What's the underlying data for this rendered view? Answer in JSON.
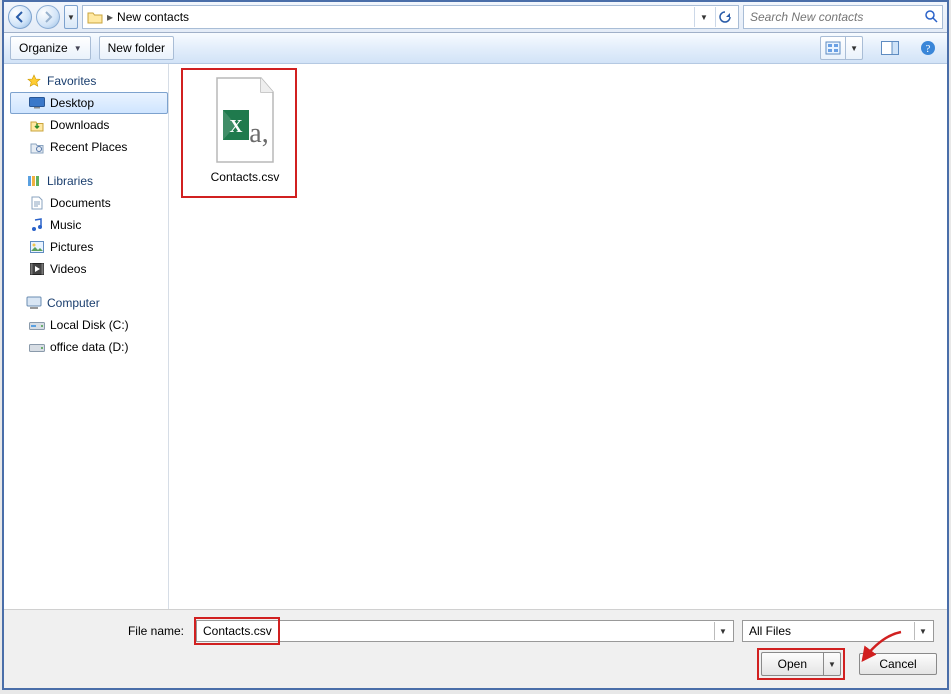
{
  "addressbar": {
    "location": "New contacts",
    "search_placeholder": "Search New contacts"
  },
  "toolbar": {
    "organize": "Organize",
    "new_folder": "New folder"
  },
  "nav": {
    "favorites": {
      "label": "Favorites",
      "items": [
        {
          "label": "Desktop",
          "selected": true
        },
        {
          "label": "Downloads",
          "selected": false
        },
        {
          "label": "Recent Places",
          "selected": false
        }
      ]
    },
    "libraries": {
      "label": "Libraries",
      "items": [
        {
          "label": "Documents"
        },
        {
          "label": "Music"
        },
        {
          "label": "Pictures"
        },
        {
          "label": "Videos"
        }
      ]
    },
    "computer": {
      "label": "Computer",
      "items": [
        {
          "label": "Local Disk (C:)"
        },
        {
          "label": "office data (D:)"
        }
      ]
    }
  },
  "files": [
    {
      "name": "Contacts.csv",
      "type": "csv"
    }
  ],
  "footer": {
    "filename_label": "File name:",
    "filename_value": "Contacts.csv",
    "filter_value": "All Files",
    "open": "Open",
    "cancel": "Cancel"
  }
}
